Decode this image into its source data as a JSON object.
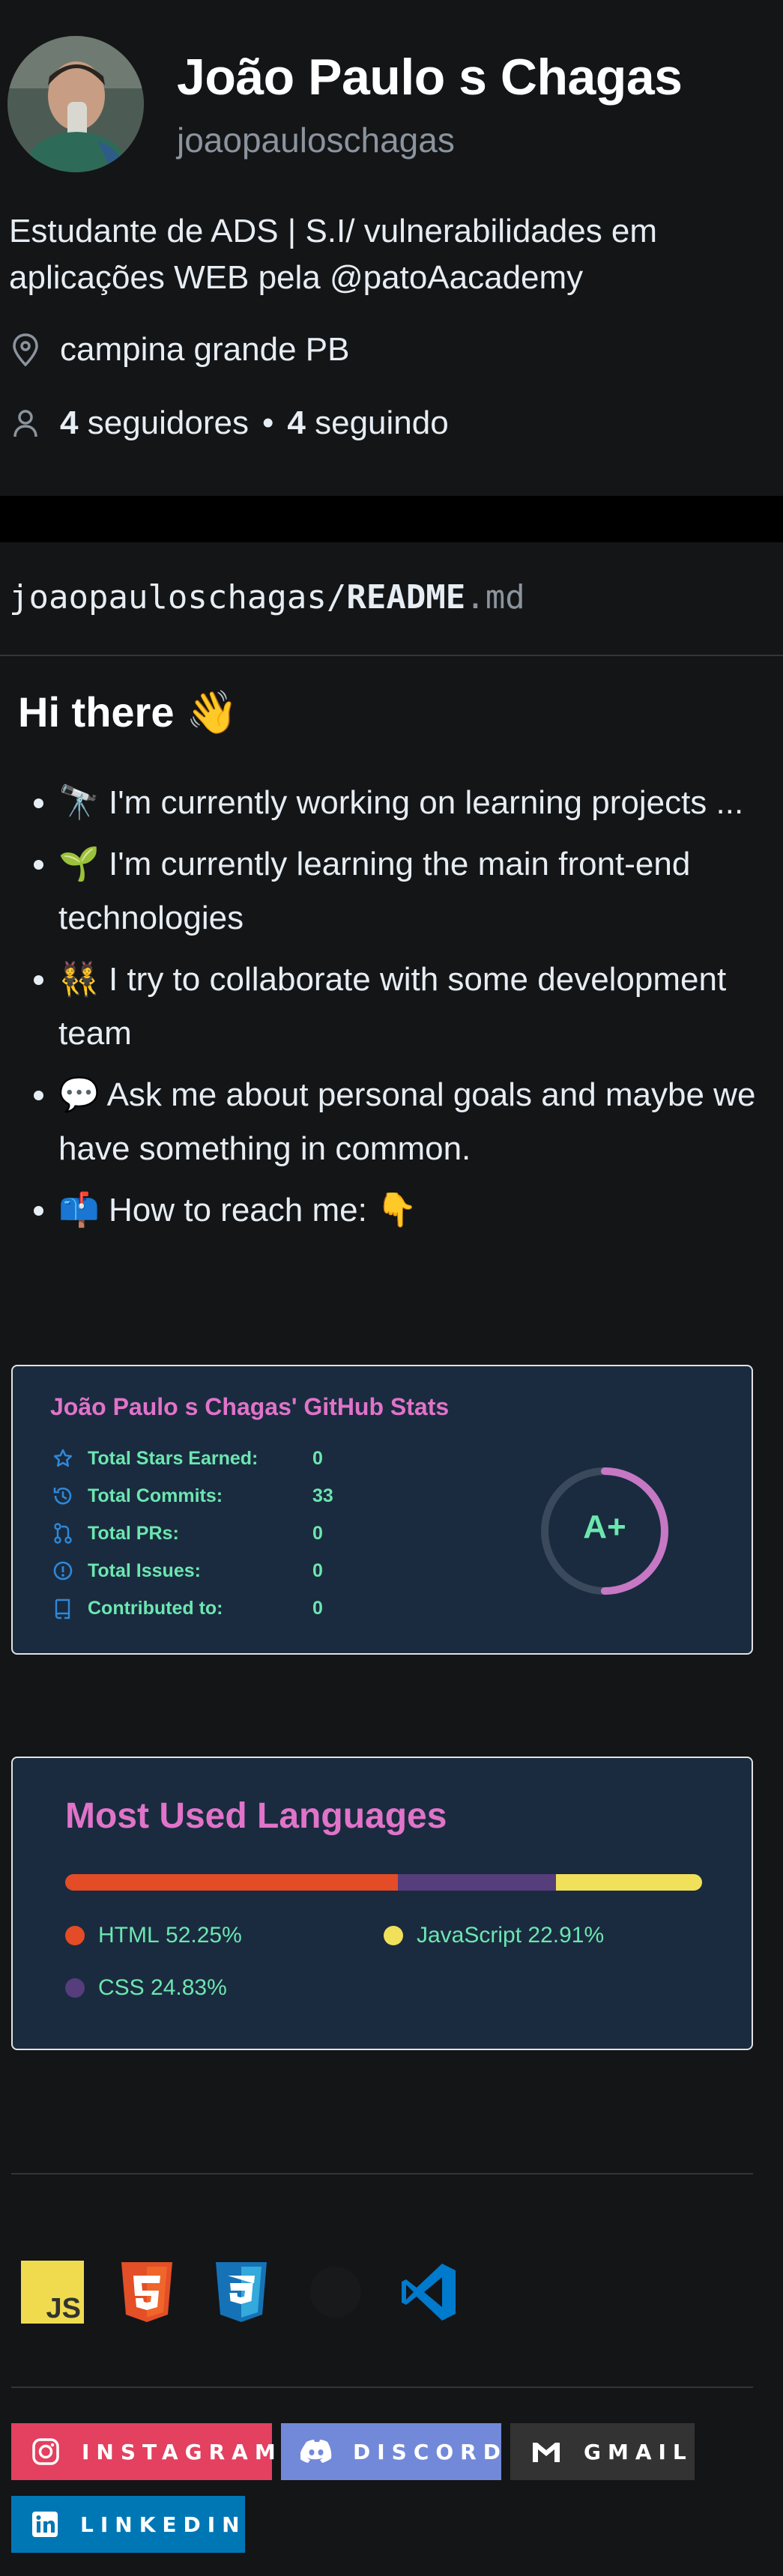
{
  "profile": {
    "name": "João Paulo s Chagas",
    "login": "joaopauloschagas",
    "bio": "Estudante de ADS | S.I/ vulnerabilidades em aplicações WEB pela @patoAacademy",
    "location": "campina grande PB",
    "followers_count": "4",
    "followers_label": "seguidores",
    "separator": "•",
    "following_count": "4",
    "following_label": "seguindo"
  },
  "readme": {
    "owner": "joaopauloschagas/",
    "file": "README",
    "ext": ".md",
    "heading": "Hi there 👋",
    "items": [
      "🔭 I'm currently working on learning projects ...",
      "🌱 I'm currently learning the main front-end technologies",
      "👯 I try to collaborate with some development team",
      "💬 Ask me about personal goals and maybe we have something in common.",
      "📫 How to reach me: 👇"
    ]
  },
  "stats_card": {
    "title": "João Paulo s Chagas' GitHub Stats",
    "rows": [
      {
        "label": "Total Stars Earned:",
        "value": "0",
        "icon": "star-icon"
      },
      {
        "label": "Total Commits:",
        "value": "33",
        "icon": "history-icon"
      },
      {
        "label": "Total PRs:",
        "value": "0",
        "icon": "pull-request-icon"
      },
      {
        "label": "Total Issues:",
        "value": "0",
        "icon": "issue-icon"
      },
      {
        "label": "Contributed to:",
        "value": "0",
        "icon": "repo-icon"
      }
    ],
    "grade": "A+",
    "grade_ring_fraction": 0.5,
    "colors": {
      "title": "#e173c9",
      "text": "#6ce6b0",
      "icon": "#2f88d8",
      "bg": "#1a2b3f"
    }
  },
  "languages_card": {
    "title": "Most Used Languages",
    "languages": [
      {
        "name": "HTML",
        "percent_label": "52.25%",
        "percent": 52.25,
        "color": "#e34c26"
      },
      {
        "name": "CSS",
        "percent_label": "24.83%",
        "percent": 24.83,
        "color": "#563d7c"
      },
      {
        "name": "JavaScript",
        "percent_label": "22.91%",
        "percent": 22.91,
        "color": "#f1e05a"
      }
    ]
  },
  "tech_icons": [
    "javascript-icon",
    "html5-icon",
    "css3-icon",
    "github-icon",
    "vscode-icon"
  ],
  "social": {
    "instagram": {
      "label": "INSTAGRAM",
      "color": "#e4405f"
    },
    "discord": {
      "label": "DISCORD",
      "color": "#7289da"
    },
    "gmail": {
      "label": "GMAIL",
      "color": "#333333"
    },
    "linkedin": {
      "label": "LINKEDIN",
      "color": "#0077b5"
    }
  }
}
